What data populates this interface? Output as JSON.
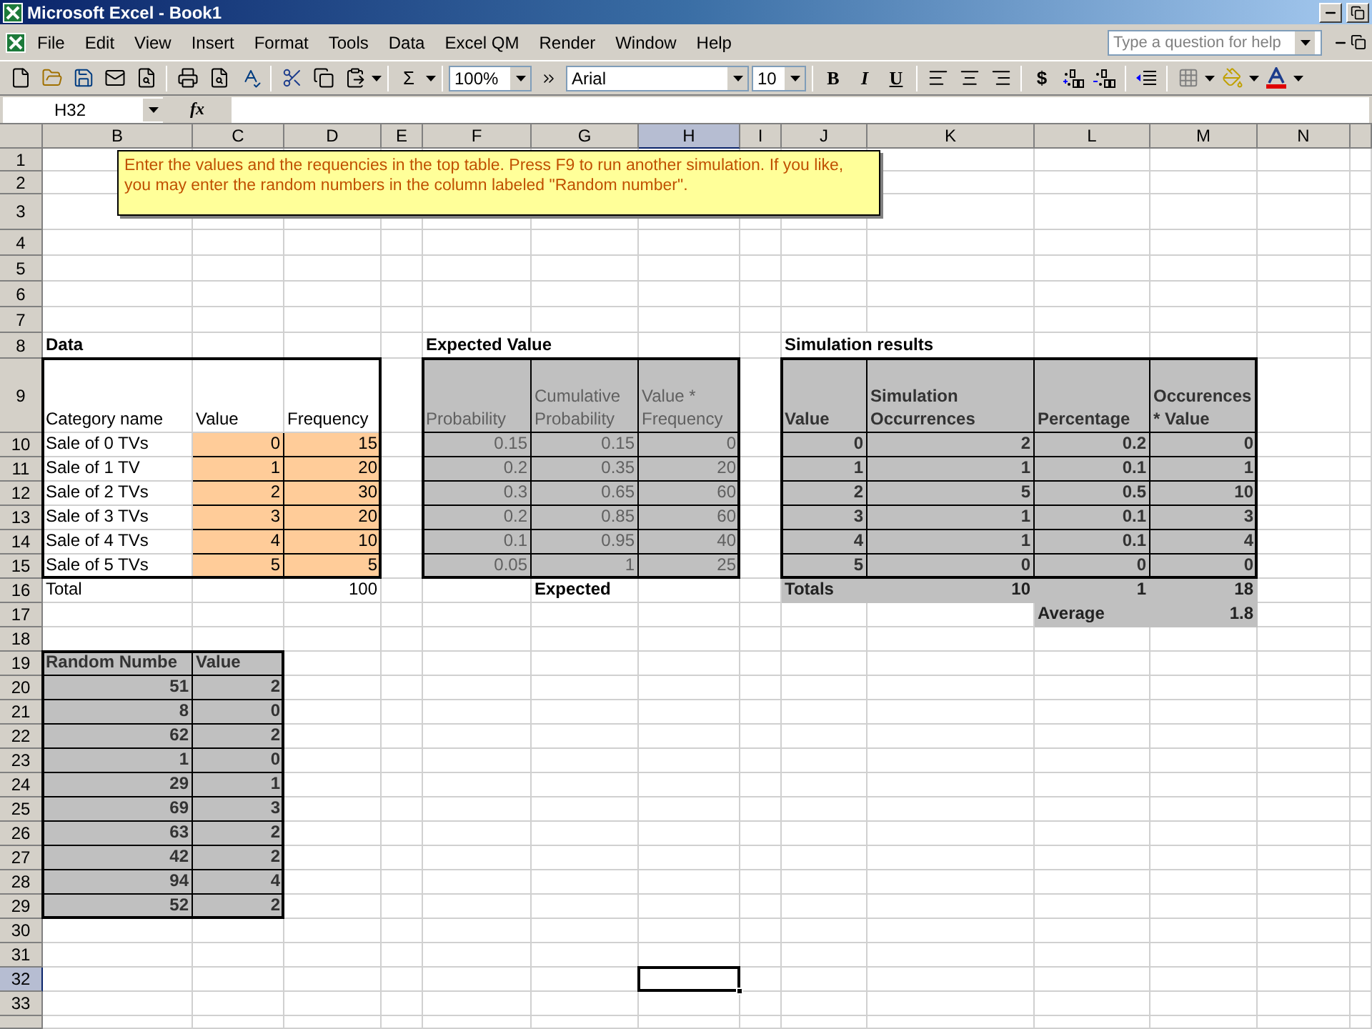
{
  "window": {
    "title": "Microsoft Excel - Book1"
  },
  "menu": [
    "File",
    "Edit",
    "View",
    "Insert",
    "Format",
    "Tools",
    "Data",
    "Excel QM",
    "Render",
    "Window",
    "Help"
  ],
  "help_box": {
    "placeholder": "Type a question for help"
  },
  "toolbar": {
    "sum": "Σ",
    "zoom": "100%",
    "font": "Arial",
    "size": "10",
    "bold": "B",
    "italic": "I",
    "underline": "U",
    "currency": "$"
  },
  "formula_bar": {
    "name_box": "H32",
    "fx": "fx"
  },
  "columns": [
    "B",
    "C",
    "D",
    "E",
    "F",
    "G",
    "H",
    "I",
    "J",
    "K",
    "L",
    "M",
    "N"
  ],
  "rows": [
    "1",
    "2",
    "3",
    "4",
    "5",
    "6",
    "7",
    "8",
    "9",
    "10",
    "11",
    "12",
    "13",
    "14",
    "15",
    "16",
    "17",
    "18",
    "19",
    "20",
    "21",
    "22",
    "23",
    "24",
    "25",
    "26",
    "27",
    "28",
    "29",
    "30",
    "31",
    "32",
    "33"
  ],
  "comment": "Enter the values and the requencies in the top table. Press F9 to run another simulation. If you like, you may enter the random numbers in the column labeled \"Random number\".",
  "data_table": {
    "title": "Data",
    "headers": [
      "Category name",
      "Value",
      "Frequency"
    ],
    "rows": [
      {
        "name": "Sale of 0 TVs",
        "value": "0",
        "frequency": "15"
      },
      {
        "name": "Sale of 1 TV",
        "value": "1",
        "frequency": "20"
      },
      {
        "name": "Sale of 2 TVs",
        "value": "2",
        "frequency": "30"
      },
      {
        "name": "Sale of 3 TVs",
        "value": "3",
        "frequency": "20"
      },
      {
        "name": "Sale of 4 TVs",
        "value": "4",
        "frequency": "10"
      },
      {
        "name": "Sale of 5 TVs",
        "value": "5",
        "frequency": "5"
      }
    ],
    "total": {
      "label": "Total",
      "value": "100"
    }
  },
  "expected_table": {
    "title": "Expected Value",
    "headers": [
      "Probability",
      "Cumulative Probability",
      "Value * Frequency"
    ],
    "rows": [
      [
        "0.15",
        "0.15",
        "0"
      ],
      [
        "0.2",
        "0.35",
        "20"
      ],
      [
        "0.3",
        "0.65",
        "60"
      ],
      [
        "0.2",
        "0.85",
        "60"
      ],
      [
        "0.1",
        "0.95",
        "40"
      ],
      [
        "0.05",
        "1",
        "25"
      ]
    ],
    "footer": "Expected"
  },
  "simulation_table": {
    "title": "Simulation results",
    "headers": [
      "Value",
      "Simulation Occurrences",
      "Percentage",
      "Occurences * Value"
    ],
    "rows": [
      [
        "0",
        "2",
        "0.2",
        "0"
      ],
      [
        "1",
        "1",
        "0.1",
        "1"
      ],
      [
        "2",
        "5",
        "0.5",
        "10"
      ],
      [
        "3",
        "1",
        "0.1",
        "3"
      ],
      [
        "4",
        "1",
        "0.1",
        "4"
      ],
      [
        "5",
        "0",
        "0",
        "0"
      ]
    ],
    "totals": [
      "Totals",
      "10",
      "1",
      "18"
    ],
    "average": [
      "Average",
      "1.8"
    ]
  },
  "random_table": {
    "headers": [
      "Random Numbe",
      "Value"
    ],
    "rows": [
      [
        "51",
        "2"
      ],
      [
        "8",
        "0"
      ],
      [
        "62",
        "2"
      ],
      [
        "1",
        "0"
      ],
      [
        "29",
        "1"
      ],
      [
        "69",
        "3"
      ],
      [
        "63",
        "2"
      ],
      [
        "42",
        "2"
      ],
      [
        "94",
        "4"
      ],
      [
        "52",
        "2"
      ]
    ]
  }
}
